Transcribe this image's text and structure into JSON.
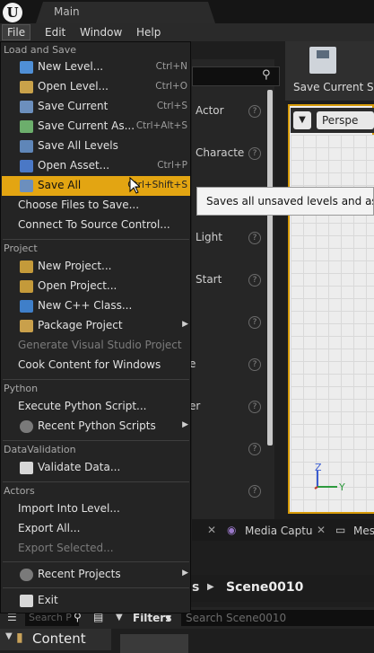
{
  "window": {
    "title": "Main"
  },
  "menubar": {
    "items": [
      "File",
      "Edit",
      "Window",
      "Help"
    ],
    "active": "File"
  },
  "file_menu": {
    "sections": {
      "load_and_save": "Load and Save",
      "project": "Project",
      "python": "Python",
      "data_validation": "DataValidation",
      "actors": "Actors"
    },
    "items": [
      {
        "label": "New Level...",
        "shortcut": "Ctrl+N",
        "icon": "new-level-icon",
        "color": "#4f8fd6"
      },
      {
        "label": "Open Level...",
        "shortcut": "Ctrl+O",
        "icon": "open-level-icon",
        "color": "#c9a24a"
      },
      {
        "label": "Save Current",
        "shortcut": "Ctrl+S",
        "icon": "save-icon",
        "color": "#6c8fbd"
      },
      {
        "label": "Save Current As...",
        "shortcut": "Ctrl+Alt+S",
        "icon": "save-as-icon",
        "color": "#6cae6c"
      },
      {
        "label": "Save All Levels",
        "shortcut": "",
        "icon": "save-all-levels-icon",
        "color": "#5f86b8"
      },
      {
        "label": "Open Asset...",
        "shortcut": "Ctrl+P",
        "icon": "open-asset-icon",
        "color": "#4a78c6"
      },
      {
        "label": "Save All",
        "shortcut": "Ctrl+Shift+S",
        "icon": "save-all-icon",
        "color": "#6c8fbd"
      },
      {
        "label": "Choose Files to Save...",
        "shortcut": "",
        "icon": "",
        "color": ""
      },
      {
        "label": "Connect To Source Control...",
        "shortcut": "",
        "icon": "",
        "color": ""
      },
      {
        "label": "New Project...",
        "shortcut": "",
        "icon": "new-project-icon",
        "color": "#c49a3a"
      },
      {
        "label": "Open Project...",
        "shortcut": "",
        "icon": "open-project-icon",
        "color": "#c49a3a"
      },
      {
        "label": "New C++ Class...",
        "shortcut": "",
        "icon": "cpp-class-icon",
        "color": "#3f7fc9"
      },
      {
        "label": "Package Project",
        "shortcut": "",
        "icon": "package-icon",
        "color": "#c9a04b"
      },
      {
        "label": "Generate Visual Studio Project",
        "shortcut": "",
        "icon": "",
        "color": ""
      },
      {
        "label": "Cook Content for Windows",
        "shortcut": "",
        "icon": "",
        "color": ""
      },
      {
        "label": "Execute Python Script...",
        "shortcut": "",
        "icon": "",
        "color": ""
      },
      {
        "label": "Recent Python Scripts",
        "shortcut": "",
        "icon": "recent-scripts-icon",
        "color": "#7a7a7a"
      },
      {
        "label": "Validate Data...",
        "shortcut": "",
        "icon": "validate-icon",
        "color": "#d7d7d7"
      },
      {
        "label": "Import Into Level...",
        "shortcut": "",
        "icon": "",
        "color": ""
      },
      {
        "label": "Export All...",
        "shortcut": "",
        "icon": "",
        "color": ""
      },
      {
        "label": "Export Selected...",
        "shortcut": "",
        "icon": "",
        "color": ""
      },
      {
        "label": "Recent Projects",
        "shortcut": "",
        "icon": "recent-projects-icon",
        "color": "#7a7a7a"
      },
      {
        "label": "Exit",
        "shortcut": "",
        "icon": "exit-icon",
        "color": "#d7d7d7"
      }
    ],
    "highlighted": "Save All"
  },
  "tooltip": "Saves all unsaved levels and assets to disk",
  "toolbar": {
    "save_current": "Save Current",
    "truncated_next": "S"
  },
  "place_labels": [
    "Actor",
    "Characte",
    "Light",
    "Start",
    "e",
    "er"
  ],
  "viewport": {
    "perspective": "Perspe",
    "gizmo_z": "Z",
    "gizmo_y": "Y"
  },
  "bottom_tabs": [
    "Media Captu",
    "Mes"
  ],
  "breadcrumb": {
    "prefix": "s",
    "current": "Scene0010"
  },
  "content_browser": {
    "filters": "Filters",
    "search_placeholder": "Search Scene0010",
    "sidebar_search": "Search P",
    "content_label": "Content"
  },
  "accent_color": "#e3a512"
}
